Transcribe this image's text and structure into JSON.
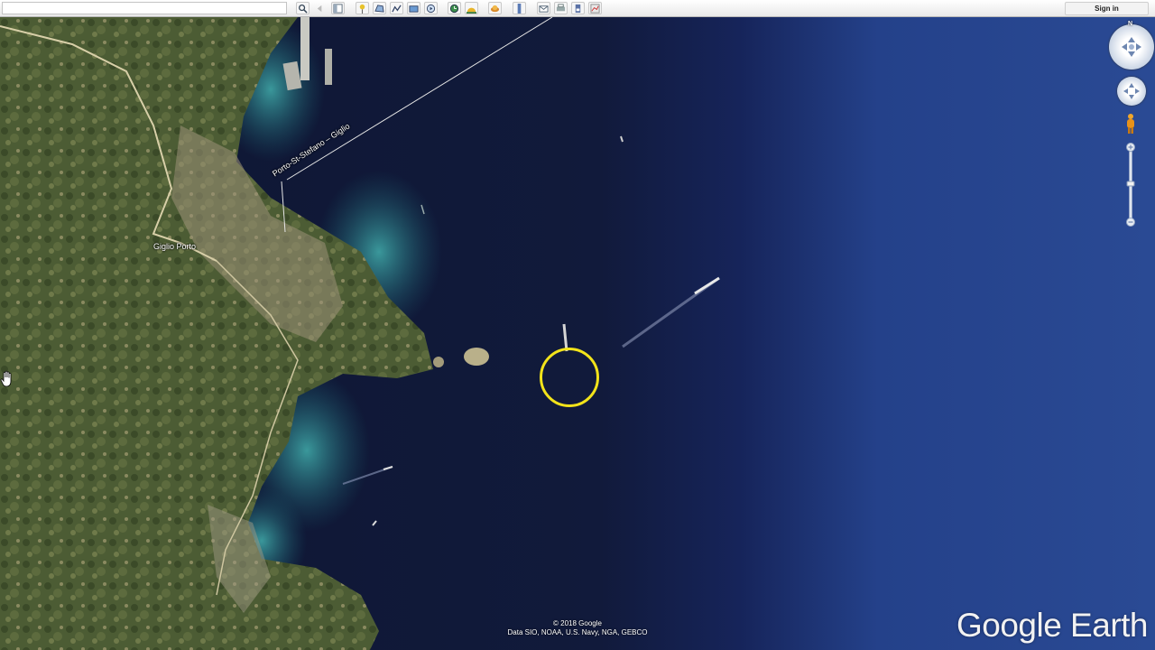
{
  "toolbar": {
    "search_placeholder": "",
    "icons": [
      "search-icon",
      "back-icon",
      "sidebar-icon",
      "placemark-icon",
      "polygon-icon",
      "path-icon",
      "overlay-icon",
      "tour-icon",
      "sun-icon",
      "historical-imagery-icon",
      "planet-icon",
      "ruler-icon",
      "email-icon",
      "print-icon",
      "save-image-icon",
      "maps-icon"
    ],
    "sign_in_label": "Sign in"
  },
  "map": {
    "place_label": "Giglio Porto",
    "ferry_route_label": "Porto-St-Stefano – Giglio",
    "attribution_line1": "© 2018 Google",
    "attribution_line2": "Data SIO, NOAA, U.S. Navy, NGA, GEBCO",
    "logo_text": "Google Earth"
  },
  "navigation": {
    "compass_label": "N"
  },
  "colors": {
    "deep_sea": "#0d1530",
    "open_sea": "#233f85",
    "cursor_ring": "#f2e31a",
    "land": "#4f5f36"
  }
}
